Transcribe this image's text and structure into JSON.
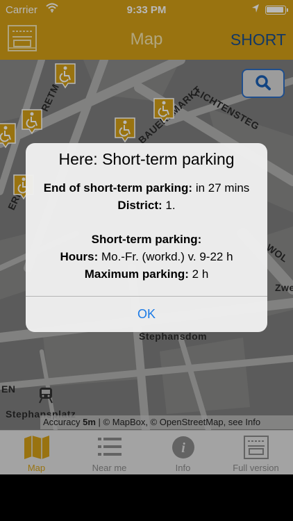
{
  "status_bar": {
    "carrier": "Carrier",
    "time": "9:33 PM"
  },
  "nav": {
    "title": "Map",
    "right_button": "SHORT"
  },
  "map": {
    "labels": [
      "BAUERNMARKT",
      "LICHTENSTEG",
      "Stephansdom",
      "Stephansplatz",
      "Zwe",
      "WOL",
      "RETM",
      "EN",
      "ERN"
    ],
    "attribution_prefix": "Accuracy",
    "attribution_accuracy": "5m",
    "attribution_suffix": "| © MapBox, © OpenStreetMap, see Info",
    "icons": [
      "search-icon",
      "wheelchair-icon",
      "metro-icon"
    ]
  },
  "alert": {
    "title": "Here: Short-term parking",
    "line1_label": "End of short-term parking:",
    "line1_value": " in 27 mins",
    "line2_label": "District:",
    "line2_value": " 1.",
    "section_title": "Short-term parking:",
    "hours_label": "Hours:",
    "hours_value": " Mo.-Fr. (workd.) v. 9-22 h",
    "max_label": "Maximum parking:",
    "max_value": " 2 h",
    "ok_label": "OK"
  },
  "tabs": [
    {
      "label": "Map",
      "icon": "map-icon",
      "active": true
    },
    {
      "label": "Near me",
      "icon": "list-icon",
      "active": false
    },
    {
      "label": "Info",
      "icon": "info-icon",
      "active": false
    },
    {
      "label": "Full version",
      "icon": "full-version-icon",
      "active": false
    }
  ],
  "colors": {
    "accent": "#d4a017",
    "link": "#1a7ae6",
    "nav_right": "#1a4d8c",
    "map_bg": "#7c7c7b"
  }
}
